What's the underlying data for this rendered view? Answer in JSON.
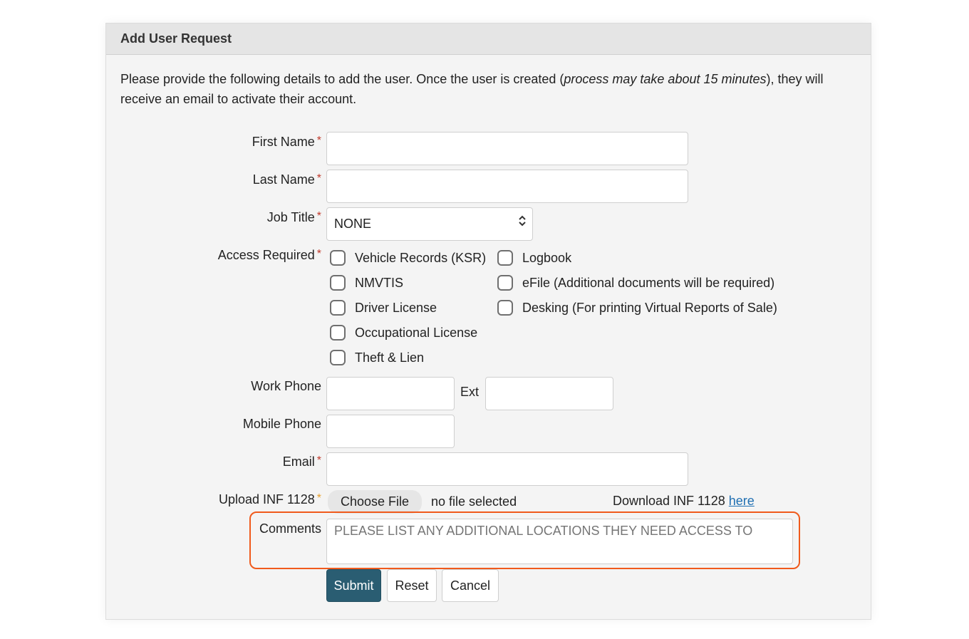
{
  "header": {
    "title": "Add User Request"
  },
  "intro": {
    "part1": "Please provide the following details to add the user. Once the user is created (",
    "italic": "process may take about 15 minutes",
    "part2": "), they will receive an email to activate their account."
  },
  "form": {
    "required_marker": "*",
    "first_name": {
      "label": "First Name",
      "value": ""
    },
    "last_name": {
      "label": "Last Name",
      "value": ""
    },
    "job_title": {
      "label": "Job Title",
      "selected": "NONE"
    },
    "access": {
      "label": "Access Required",
      "options": [
        "Vehicle Records (KSR)",
        "NMVTIS",
        "Driver License",
        "Occupational License",
        "Theft & Lien",
        "Logbook",
        "eFile (Additional documents will be required)",
        "Desking (For printing Virtual Reports of Sale)"
      ]
    },
    "work_phone": {
      "label": "Work Phone",
      "value": ""
    },
    "ext": {
      "label": "Ext",
      "value": ""
    },
    "mobile_phone": {
      "label": "Mobile Phone",
      "value": ""
    },
    "email": {
      "label": "Email",
      "value": ""
    },
    "upload": {
      "label": "Upload INF 1128",
      "button": "Choose File",
      "status": "no file selected",
      "download_text": "Download INF 1128",
      "download_link": "here"
    },
    "comments": {
      "label": "Comments",
      "placeholder": "PLEASE LIST ANY ADDITIONAL LOCATIONS THEY NEED ACCESS TO"
    }
  },
  "buttons": {
    "submit": "Submit",
    "reset": "Reset",
    "cancel": "Cancel"
  },
  "colors": {
    "primary": "#2a5d72",
    "required": "#c0392b",
    "optional_required": "#e8a02d",
    "highlight": "#f05a1c",
    "link": "#1f6fb2"
  }
}
